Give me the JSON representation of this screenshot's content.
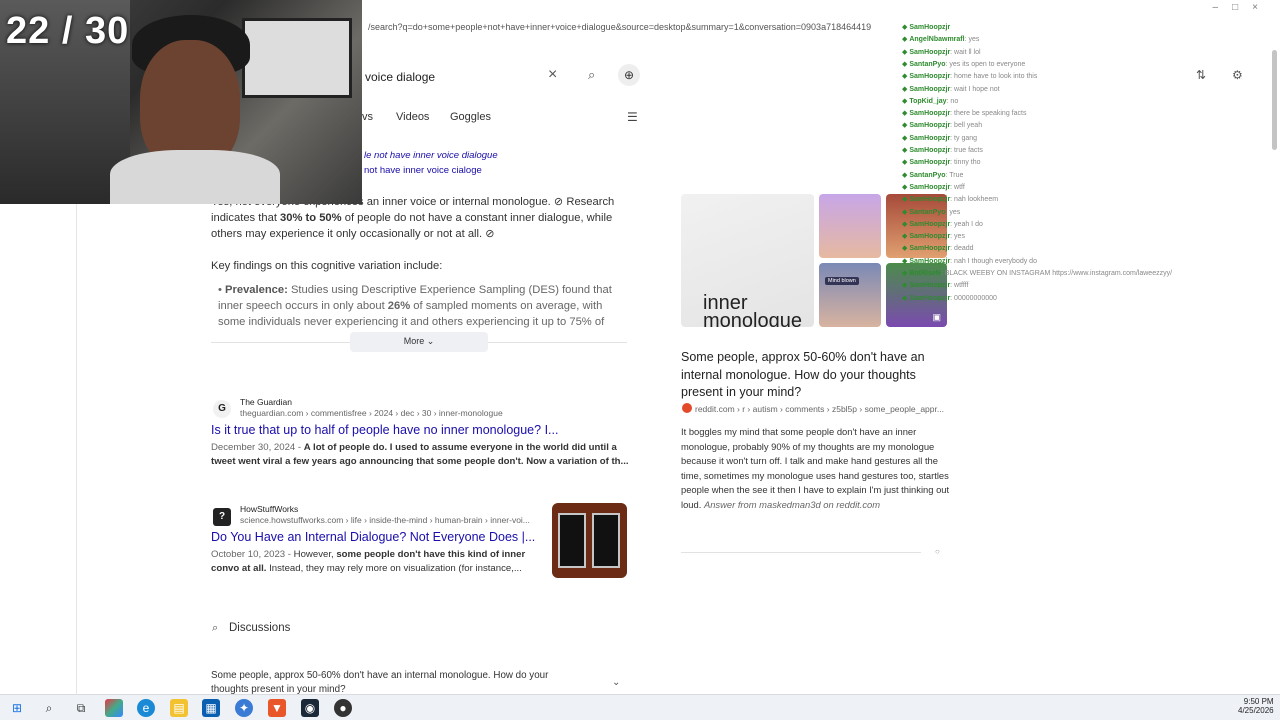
{
  "counter": "22 / 30",
  "browser": {
    "url": "/search?q=do+some+people+not+have+inner+voice+dialogue&source=desktop&summary=1&conversation=0903a718464419",
    "search_value": "voice dialoge",
    "tabs": [
      "vs",
      "Videos",
      "Goggles"
    ]
  },
  "summary": {
    "suggestion1": "le not have inner voice dialogue",
    "suggestion2": "not have inner voice cialoge",
    "para1_a": "Yes, not everyone experiences an inner voice or internal monologue.",
    "para1_b": "Research indicates that",
    "para1_bold": "30% to 50%",
    "para1_c": "of people do not have a constant inner dialogue, while others may experience it only occasionally or not at all.",
    "key_findings": "Key findings on this cognitive variation include:",
    "prevalence_label": "Prevalence:",
    "prevalence_text": "Studies using Descriptive Experience Sampling (DES) found that inner speech occurs in only about",
    "prevalence_bold": "26%",
    "prevalence_text2": "of sampled moments on average, with some individuals never experiencing it and others experiencing it up to 75% of",
    "more_label": "More"
  },
  "results": [
    {
      "site": "The Guardian",
      "path": "theguardian.com › commentisfree › 2024 › dec › 30 › inner-monologue",
      "title": "Is it true that up to half of people have no inner monologue? I...",
      "date": "December 30, 2024 -",
      "snippet_bold": "A lot of people do. I used to assume everyone in the world did until a tweet went viral a few years ago announcing that some people don't. Now a variation of th..."
    },
    {
      "site": "HowStuffWorks",
      "path": "science.howstuffworks.com › life › inside-the-mind › human-brain › inner-voi...",
      "title": "Do You Have an Internal Dialogue? Not Everyone Does |...",
      "date": "October 10, 2023 -",
      "snippet_a": "However,",
      "snippet_bold": "some people don't have this kind of inner convo at all.",
      "snippet_b": "Instead, they may rely more on visualization (for instance,..."
    }
  ],
  "discussions": {
    "heading": "Discussions",
    "item": "Some people, approx 50-60% don't have an internal monologue. How do your thoughts present in your mind?"
  },
  "panel": {
    "thumb_text": "inner monologue",
    "title": "Some people, approx 50-60% don't have an internal monologue. How do your thoughts present in your mind?",
    "source": "reddit.com › r › autism › comments › z5bl5p › some_people_appr...",
    "body": "It boggles my mind that some people don't have an inner monologue, probably 90% of my thoughts are my monologue because it won't turn off. I talk and make hand gestures all the time, sometimes my monologue uses hand gestures too, startles people when the see it then I have to explain I'm just thinking out loud.",
    "attribution": "Answer from maskedman3d on reddit.com",
    "mind_blown": "Mind blown"
  },
  "chat": [
    {
      "user": "SamHoopzjr",
      "msg": ""
    },
    {
      "user": "AngelNbawmrafl",
      "msg": ": yes"
    },
    {
      "user": "SamHoopzjr",
      "msg": ": wait ll lol"
    },
    {
      "user": "SantanPyo",
      "msg": ": yes its open to everyone"
    },
    {
      "user": "SamHoopzjr",
      "msg": ": home have to look into this"
    },
    {
      "user": "SamHoopzjr",
      "msg": ": wait I hope not"
    },
    {
      "user": "TopKid_jay",
      "msg": ": no"
    },
    {
      "user": "SamHoopzjr",
      "msg": ": there be speaking facts"
    },
    {
      "user": "SamHoopzjr",
      "msg": ": bell yeah"
    },
    {
      "user": "SamHoopzjr",
      "msg": ": ty gang"
    },
    {
      "user": "SamHoopzjr",
      "msg": ": true facts"
    },
    {
      "user": "SamHoopzjr",
      "msg": ": tinny tho"
    },
    {
      "user": "SantanPyo",
      "msg": ": True"
    },
    {
      "user": "SamHoopzjr",
      "msg": ": wtff"
    },
    {
      "user": "SamHoopzjr",
      "msg": ": nah lookheem"
    },
    {
      "user": "SantanPyo",
      "msg": ": yes"
    },
    {
      "user": "SamHoopzjr",
      "msg": ": yeah I do"
    },
    {
      "user": "SamHoopzjr",
      "msg": ": yes"
    },
    {
      "user": "SamHoopzjr",
      "msg": ": deadd"
    },
    {
      "user": "SamHoopzjr",
      "msg": ": nah I though everybody do"
    },
    {
      "user": "BotRiseN",
      "msg": ": BLACK WEEBY ON INSTAGRAM https://www.instagram.com/laweezzyy/"
    },
    {
      "user": "SamHoopzjr",
      "msg": ": wtffff"
    },
    {
      "user": "SamHoopzjr",
      "msg": ": 00000000000"
    }
  ],
  "taskbar": {
    "time": "9:50 PM",
    "date": "4/25/2026"
  }
}
